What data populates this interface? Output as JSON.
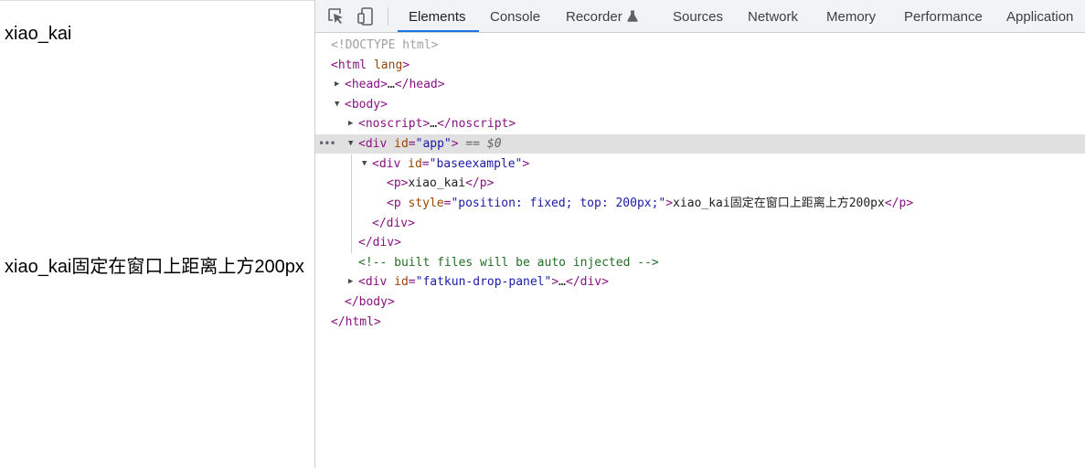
{
  "page": {
    "text1": "xiao_kai",
    "text2": "xiao_kai固定在窗口上距离上方200px"
  },
  "toolbar": {
    "tabs": [
      "Elements",
      "Console",
      "Recorder",
      "Sources",
      "Network",
      "Memory",
      "Performance",
      "Application"
    ],
    "active_tab": "Elements",
    "accent": "#1a73e8"
  },
  "tree": {
    "doctype": "<!DOCTYPE html>",
    "html_open": "<html",
    "html_attr": "lang",
    "html_close_bracket": ">",
    "head_open": "<head>",
    "head_ell": "…",
    "head_close": "</head>",
    "body_open": "<body>",
    "noscript_open": "<noscript>",
    "noscript_ell": "…",
    "noscript_close": "</noscript>",
    "div_open": "<div",
    "attr_id": "id",
    "app_val": "\"app\"",
    "eq0": "== $0",
    "baseexample_val": "\"baseexample\"",
    "p_open": "<p>",
    "p1_text": "xiao_kai",
    "p_close": "</p>",
    "p_tag": "<p",
    "attr_style": "style",
    "style_val": "\"position: fixed; top: 200px;\"",
    "p2_text": "xiao_kai固定在窗口上距离上方200px",
    "gt": ">",
    "eqsign": "=",
    "div_close": "</div>",
    "comment": "<!-- built files will be auto injected -->",
    "fatkun_val": "\"fatkun-drop-panel\"",
    "fatkun_ell": "…",
    "body_close": "</body>",
    "html_close": "</html>"
  }
}
